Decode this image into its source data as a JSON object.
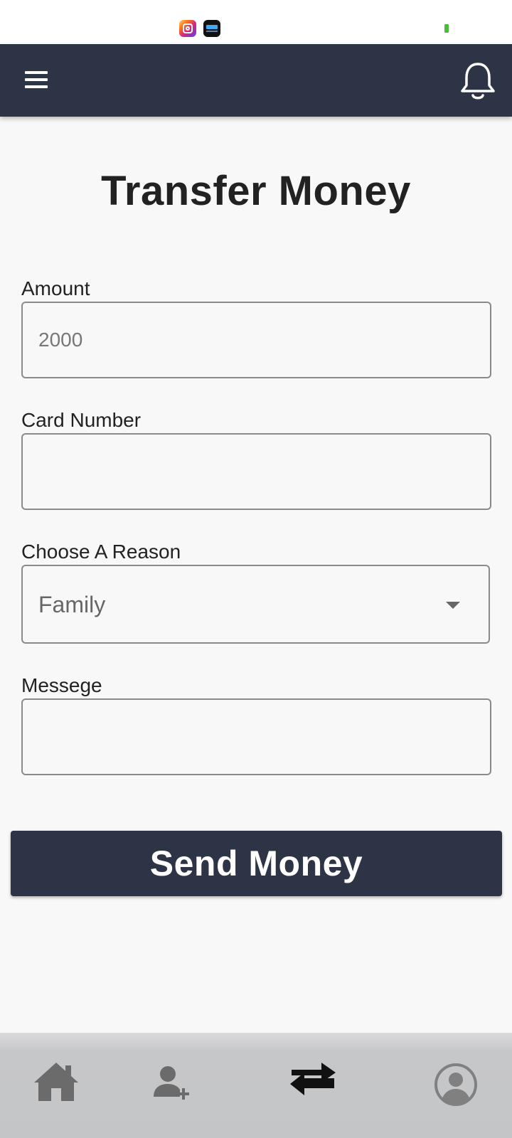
{
  "status_bar": {
    "icons": [
      "instagram-icon",
      "app365-icon"
    ],
    "battery_color": "#4cbb3c"
  },
  "header": {
    "background": "#2d3446",
    "menu_icon": "menu-icon",
    "notification_icon": "bell-icon"
  },
  "page": {
    "title": "Transfer Money"
  },
  "form": {
    "amount": {
      "label": "Amount",
      "value": "2000"
    },
    "card_number": {
      "label": "Card Number",
      "value": ""
    },
    "reason": {
      "label": "Choose A Reason",
      "selected": "Family"
    },
    "message": {
      "label": "Messege",
      "value": ""
    },
    "submit_label": "Send Money"
  },
  "bottom_nav": {
    "items": [
      {
        "icon": "home-icon",
        "active": false
      },
      {
        "icon": "add-user-icon",
        "active": false
      },
      {
        "icon": "transfer-icon",
        "active": true
      },
      {
        "icon": "profile-icon",
        "active": false
      }
    ]
  }
}
